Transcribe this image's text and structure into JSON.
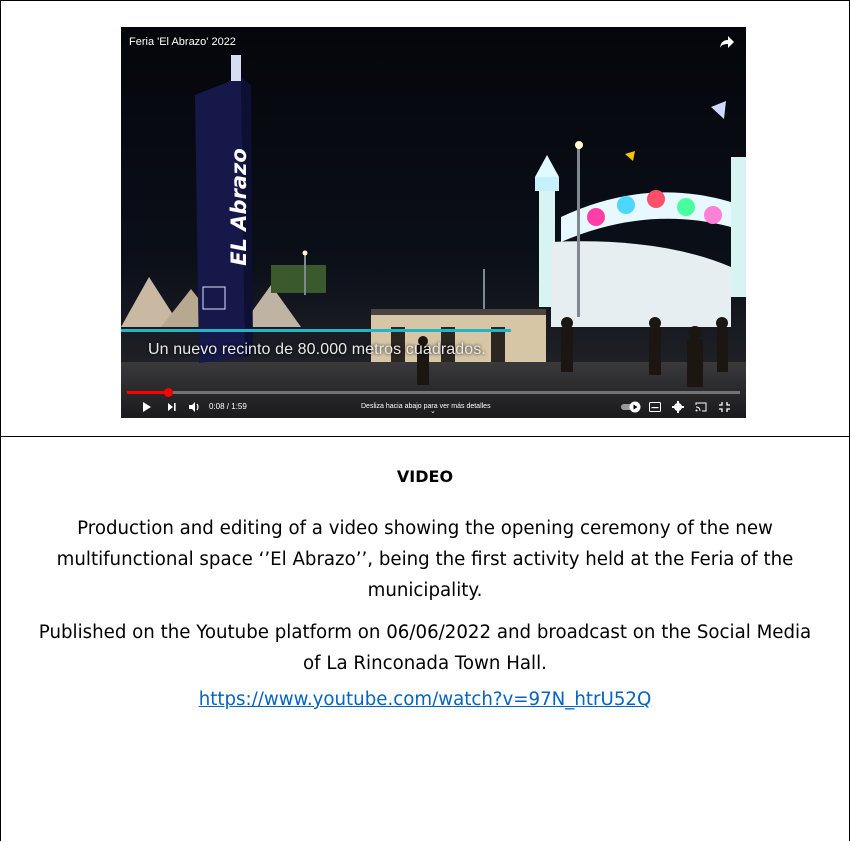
{
  "player": {
    "title": "Feria 'El Abrazo' 2022",
    "subtitle": "Un nuevo recinto de 80.000 metros cuadrados.",
    "time": "0:08 / 1:59",
    "hint": "Desliza hacia abajo para ver más detalles",
    "totem_text": "EL Abrazo",
    "progress": 0.067,
    "progress_color": "#ff0000"
  },
  "content": {
    "heading": "VIDEO",
    "paragraph1": "Production and editing of a video showing the opening ceremony of the new multifunctional space ‘’El Abrazo’’, being the first activity held at the Feria of the municipality.",
    "paragraph2": "Published on the Youtube platform on 06/06/2022 and broadcast on the Social Media of La Rinconada Town Hall.",
    "link": "https://www.youtube.com/watch?v=97N_htrU52Q",
    "link_color": "#0563c1"
  }
}
